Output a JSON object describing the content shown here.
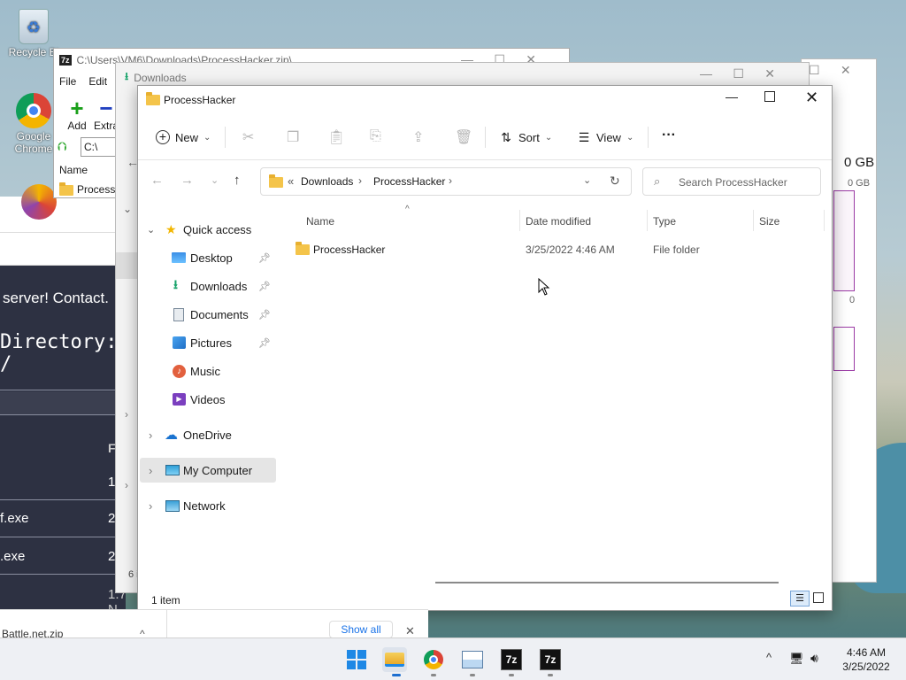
{
  "desktop": {
    "icons": [
      {
        "label": "Recycle Bi"
      },
      {
        "label": "Google Chrome"
      }
    ]
  },
  "sevenzip": {
    "title": "C:\\Users\\VM6\\Downloads\\ProcessHacker.zip\\",
    "menu": [
      "File",
      "Edit"
    ],
    "toolbar": [
      "Add",
      "Extra"
    ],
    "path": "C:\\",
    "col_name": "Name",
    "row": "ProcessH"
  },
  "downloads_window": {
    "title": "Downloads",
    "side_text": "6 i"
  },
  "taskman": {
    "gb1": "0 GB",
    "gb2": "0 GB",
    "zero": "0"
  },
  "browser": {
    "line1": "server! Contact.",
    "line2": "Directory: /",
    "col": "F",
    "rows": [
      {
        "name": "",
        "val": "1"
      },
      {
        "name": "f.exe",
        "val": "2"
      },
      {
        "name": ".exe",
        "val": "2"
      },
      {
        "name": "",
        "val": "1.7 N"
      }
    ],
    "download_bar": {
      "file": "Battle.net.zip",
      "show_all": "Show all"
    }
  },
  "explorer": {
    "title": "ProcessHacker",
    "toolbar": {
      "new": "New",
      "sort": "Sort",
      "view": "View",
      "more": "···"
    },
    "breadcrumb": {
      "prefix": "«",
      "items": [
        "Downloads",
        "ProcessHacker"
      ]
    },
    "search_placeholder": "Search ProcessHacker",
    "nav": {
      "quick_access": "Quick access",
      "items": [
        "Desktop",
        "Downloads",
        "Documents",
        "Pictures",
        "Music",
        "Videos"
      ],
      "onedrive": "OneDrive",
      "my_computer": "My Computer",
      "network": "Network"
    },
    "columns": {
      "name": "Name",
      "date": "Date modified",
      "type": "Type",
      "size": "Size"
    },
    "files": [
      {
        "name": "ProcessHacker",
        "date": "3/25/2022 4:46 AM",
        "type": "File folder",
        "size": ""
      }
    ],
    "status": "1 item"
  },
  "taskbar": {
    "apps": [
      "Start",
      "File Explorer",
      "Google Chrome",
      "Task Manager",
      "7z",
      "7z"
    ],
    "time": "4:46 AM",
    "date": "3/25/2022"
  },
  "colors": {
    "accent": "#0067c0",
    "folder": "#f4c44a",
    "selected": "#e5e5e5"
  }
}
